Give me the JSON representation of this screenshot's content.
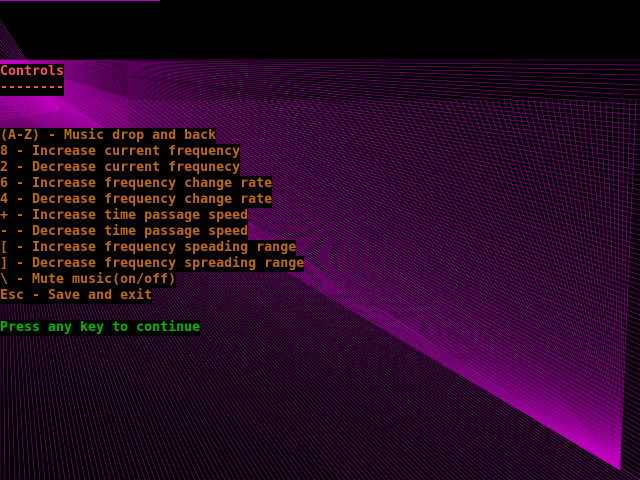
{
  "colors": {
    "pattern": "#c000c0",
    "title": "#ff5555",
    "items": "#c06a10",
    "prompt": "#00b800"
  },
  "controls": {
    "title": "Controls",
    "underline": "--------",
    "items": [
      "(A-Z) - Music drop and back",
      "8 - Increase current frequency",
      "2 - Decrease current frequnecy",
      "6 - Increase frequency change rate",
      "4 - Decrease frequency change rate",
      "+ - Increase time passage speed",
      "- - Decrease time passage speed",
      "[ - Increase frequency speading range",
      "] - Decrease frequency spreading range",
      "\\ - Mute music(on/off)",
      "Esc - Save and exit"
    ],
    "prompt": "Press any key to continue"
  }
}
